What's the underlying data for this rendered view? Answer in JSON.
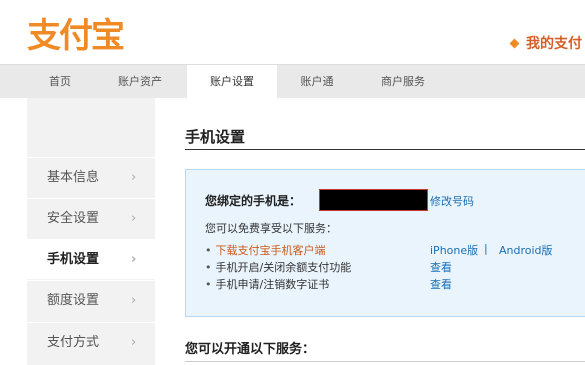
{
  "header": {
    "logo_text": "支付宝",
    "my_alipay": "我的支付"
  },
  "nav": {
    "items": [
      {
        "label": "首页"
      },
      {
        "label": "账户资产"
      },
      {
        "label": "账户设置"
      },
      {
        "label": "账户通"
      },
      {
        "label": "商户服务"
      }
    ],
    "active": "账户设置"
  },
  "sidebar": {
    "items": [
      {
        "label": "基本信息"
      },
      {
        "label": "安全设置"
      },
      {
        "label": "手机设置"
      },
      {
        "label": "额度设置"
      },
      {
        "label": "支付方式"
      }
    ],
    "active": "手机设置",
    "chevron": "›"
  },
  "main": {
    "title": "手机设置",
    "bound_label": "您绑定的手机是：",
    "change_pwd": "修改号码",
    "free_text": "您可以免费享受以下服务：",
    "services": [
      {
        "name": "下载支付宝手机客户端",
        "actions": [
          "iPhone版",
          "Android版"
        ]
      },
      {
        "name": "手机开启/关闭余额支付功能",
        "actions": [
          "查看"
        ]
      },
      {
        "name": "手机申请/注销数字证书",
        "actions": [
          "查看"
        ]
      }
    ],
    "action_separator": "|",
    "bullet": "•",
    "open_title": "您可以开通以下服务："
  },
  "colors": {
    "brand_orange": "#f08a24",
    "link_blue": "#1a6fb5",
    "info_bg": "#eaf4fc"
  }
}
